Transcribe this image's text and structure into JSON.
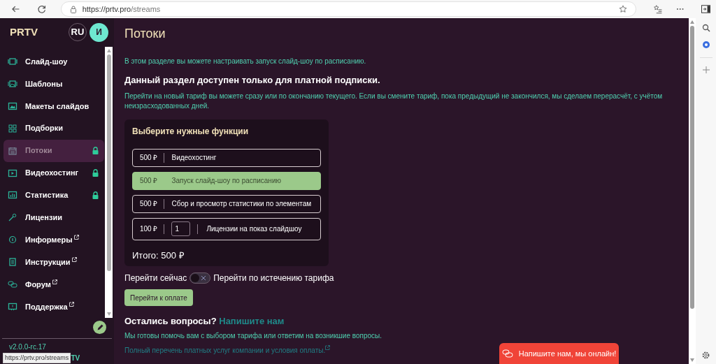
{
  "browser": {
    "url_host": "https://prtv.pro",
    "url_path": "/streams",
    "status_url": "https://prtv.pro/streams"
  },
  "sidebar": {
    "logo": "PRTV",
    "language": "RU",
    "avatar": "И",
    "items": [
      {
        "label": "Слайд-шоу",
        "selected": false,
        "locked": false,
        "external": false
      },
      {
        "label": "Шаблоны",
        "selected": false,
        "locked": false,
        "external": false
      },
      {
        "label": "Макеты слайдов",
        "selected": false,
        "locked": false,
        "external": false
      },
      {
        "label": "Подборки",
        "selected": false,
        "locked": false,
        "external": false
      },
      {
        "label": "Потоки",
        "selected": true,
        "locked": true,
        "external": false
      },
      {
        "label": "Видеохостинг",
        "selected": false,
        "locked": true,
        "external": false
      },
      {
        "label": "Статистика",
        "selected": false,
        "locked": true,
        "external": false
      },
      {
        "label": "Лицензии",
        "selected": false,
        "locked": false,
        "external": false
      },
      {
        "label": "Информеры",
        "selected": false,
        "locked": false,
        "external": true
      },
      {
        "label": "Инструкции",
        "selected": false,
        "locked": false,
        "external": true
      },
      {
        "label": "Форум",
        "selected": false,
        "locked": false,
        "external": true
      },
      {
        "label": "Поддержка",
        "selected": false,
        "locked": false,
        "external": true
      }
    ],
    "version": "v2.0.0-rc.17",
    "footer_fragment": "TV"
  },
  "page": {
    "title": "Потоки",
    "intro": "В этом разделе вы можете настраивать запуск слайд-шоу по расписанию.",
    "notice": "Данный раздел доступен только для платной подписки.",
    "explanation": "Перейти на новый тариф вы можете сразу или по окончанию текущего. Если вы смените тариф, пока предыдущий не закончился, мы сделаем перерасчёт, с учётом неизрасходованных дней.",
    "features": {
      "title": "Выберите нужные функции",
      "items": [
        {
          "kind": "option",
          "price": "500 ₽",
          "label": "Видеохостинг",
          "selected": false
        },
        {
          "kind": "option",
          "price": "500 ₽",
          "label": "Запуск слайд-шоу по расписанию",
          "selected": true
        },
        {
          "kind": "option",
          "price": "500 ₽",
          "label": "Сбор и просмотр статистики по элементам",
          "selected": false
        },
        {
          "kind": "quantity",
          "price": "100 ₽",
          "quantity": "1",
          "label": "Лицензии на показ слайдшоу",
          "selected": false
        }
      ],
      "total": "Итого: 500 ₽"
    },
    "switch": {
      "left_label": "Перейти сейчас",
      "right_label": "Перейти по истечению тарифа",
      "on": false
    },
    "pay_button": "Перейти к оплате",
    "questions": {
      "title": "Остались вопросы?",
      "link": "Напишите нам",
      "text": "Мы готовы помочь вам с выбором тарифа или ответим на возникшие вопросы.",
      "services_link": "Полный перечень платных услуг компании и условия оплаты."
    }
  },
  "chat_button": "Напишите нам, мы онлайн!"
}
